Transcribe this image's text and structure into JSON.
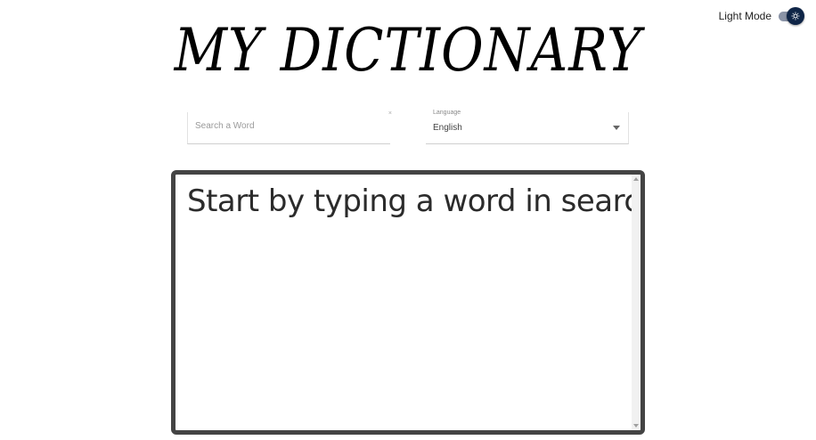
{
  "header": {
    "mode_label": "Light Mode",
    "mode_icon": "sun-icon",
    "title": "MY DICTIONARY"
  },
  "search": {
    "placeholder": "Search a Word",
    "value": ""
  },
  "language": {
    "label": "Language",
    "selected": "English"
  },
  "results": {
    "message": "Start by typing a word in search"
  },
  "colors": {
    "toggle_thumb": "#0f2547",
    "results_border": "#444444"
  }
}
